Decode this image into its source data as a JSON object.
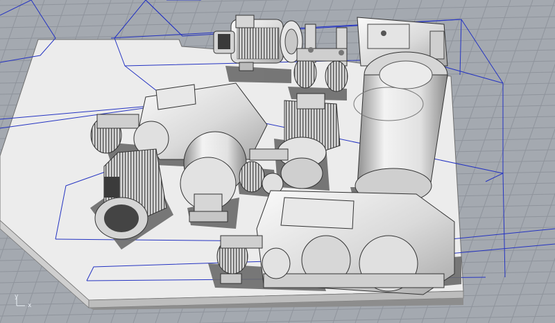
{
  "viewport": {
    "mode": "shaded-3d-perspective",
    "background": "#a4a9b0",
    "grid_color": "#8f949c",
    "boundingbox_color": "#2433c2",
    "platform_color": "#ececec",
    "machine_color": "#dcdcdc",
    "shadow_color": "#636363"
  },
  "axes": {
    "x_label": "x",
    "y_label": "y"
  },
  "objects": {
    "top_motor": "motor",
    "top_brakes": "brake",
    "top_gearbox": "gearbox",
    "drum_large": "winch-drum",
    "left_motor": "motor",
    "left_gearbox": "gearbox",
    "center_motor": "motor",
    "center_brake": "brake",
    "bottom_gearbox": "gearbox",
    "bottom_brake": "brake"
  }
}
